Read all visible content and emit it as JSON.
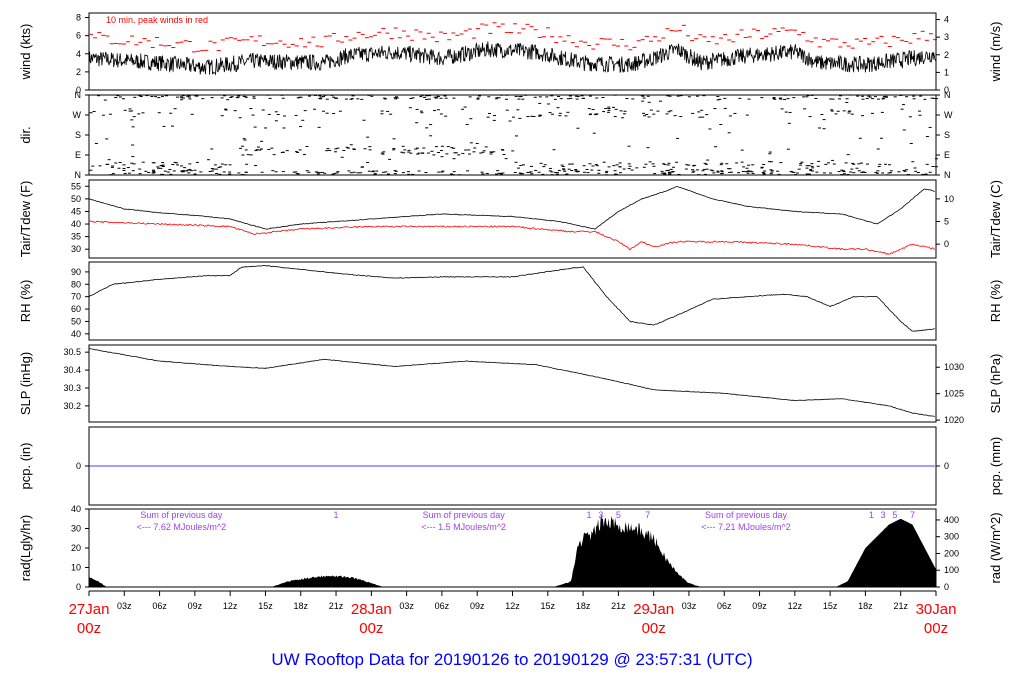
{
  "title": "UW Rooftop Data for 20190126  to  20190129 @ 23:57:31  (UTC)",
  "chart_data": [
    {
      "id": "wind",
      "type": "line",
      "ylabel": "wind (kts)",
      "ylabel_right": "wind (m/s)",
      "ylim": [
        0,
        8.5
      ],
      "yticks": [
        0,
        2,
        4,
        6,
        8
      ],
      "yticks_right": [
        0,
        1,
        2,
        3,
        4
      ],
      "right_scale": 0.5144,
      "annotation": "10 min. peak winds in red",
      "series": [
        {
          "name": "wind",
          "color": "#000000",
          "points": [
            [
              0,
              3.5
            ],
            [
              6,
              3
            ],
            [
              10,
              2.5
            ],
            [
              14,
              3.2
            ],
            [
              20,
              3
            ],
            [
              22,
              3.8
            ],
            [
              26,
              4.2
            ],
            [
              30,
              3.5
            ],
            [
              34,
              4.5
            ],
            [
              38,
              4.2
            ],
            [
              42,
              3
            ],
            [
              46,
              2.8
            ],
            [
              48,
              3.5
            ],
            [
              50,
              4.5
            ],
            [
              52,
              3
            ],
            [
              56,
              3.8
            ],
            [
              60,
              4.2
            ],
            [
              62,
              3
            ],
            [
              66,
              2.8
            ],
            [
              70,
              3.5
            ],
            [
              72,
              4
            ]
          ]
        }
      ]
    },
    {
      "id": "dir",
      "type": "scatter",
      "ylabel": "dir.",
      "ylim": [
        0,
        360
      ],
      "yticks_labels": [
        "N",
        "E",
        "S",
        "W",
        "N"
      ],
      "yticks": [
        0,
        90,
        180,
        270,
        360
      ]
    },
    {
      "id": "temp",
      "type": "line",
      "ylabel": "Tair/Tdew (F)",
      "ylabel_right": "Tair/Tdew (C)",
      "ylim": [
        26.5,
        57.5
      ],
      "yticks": [
        30,
        35,
        40,
        45,
        50,
        55
      ],
      "yticks_right": [
        0,
        5,
        10
      ],
      "series": [
        {
          "name": "Tair",
          "color": "#000000",
          "points": [
            [
              0,
              50
            ],
            [
              3,
              46
            ],
            [
              6,
              44.5
            ],
            [
              10,
              43
            ],
            [
              12,
              42
            ],
            [
              15,
              38
            ],
            [
              18,
              40
            ],
            [
              24,
              42
            ],
            [
              30,
              44
            ],
            [
              36,
              43
            ],
            [
              40,
              41
            ],
            [
              43,
              38
            ],
            [
              45,
              45
            ],
            [
              47,
              50
            ],
            [
              49,
              53
            ],
            [
              50,
              55
            ],
            [
              53,
              50
            ],
            [
              56,
              47
            ],
            [
              60,
              45
            ],
            [
              64,
              44
            ],
            [
              67,
              40
            ],
            [
              69,
              46
            ],
            [
              71,
              54
            ],
            [
              72,
              53
            ]
          ]
        },
        {
          "name": "Tdew",
          "color": "#ff0000",
          "points": [
            [
              0,
              41
            ],
            [
              6,
              40
            ],
            [
              12,
              39
            ],
            [
              14,
              36
            ],
            [
              18,
              38
            ],
            [
              24,
              39
            ],
            [
              36,
              39
            ],
            [
              41,
              37
            ],
            [
              43,
              37
            ],
            [
              44,
              35
            ],
            [
              45,
              33
            ],
            [
              46,
              30
            ],
            [
              47,
              33
            ],
            [
              48,
              31
            ],
            [
              50,
              33
            ],
            [
              54,
              33
            ],
            [
              60,
              32
            ],
            [
              64,
              30
            ],
            [
              66,
              30
            ],
            [
              68,
              28
            ],
            [
              70,
              32
            ],
            [
              72,
              30
            ]
          ]
        }
      ]
    },
    {
      "id": "rh",
      "type": "line",
      "ylabel": "RH (%)",
      "ylabel_right": "RH (%)",
      "ylim": [
        35,
        98
      ],
      "yticks": [
        40,
        50,
        60,
        70,
        80,
        90
      ],
      "series": [
        {
          "name": "RH",
          "color": "#000000",
          "points": [
            [
              0,
              70
            ],
            [
              2,
              80
            ],
            [
              6,
              84
            ],
            [
              10,
              87
            ],
            [
              12,
              87
            ],
            [
              13,
              94
            ],
            [
              15,
              95
            ],
            [
              18,
              92
            ],
            [
              22,
              88
            ],
            [
              26,
              85
            ],
            [
              30,
              86
            ],
            [
              36,
              86
            ],
            [
              41,
              93
            ],
            [
              42,
              94
            ],
            [
              44,
              70
            ],
            [
              46,
              50
            ],
            [
              48,
              47
            ],
            [
              50,
              55
            ],
            [
              53,
              68
            ],
            [
              56,
              70
            ],
            [
              59,
              72
            ],
            [
              61,
              70
            ],
            [
              63,
              62
            ],
            [
              65,
              70
            ],
            [
              67,
              70
            ],
            [
              69,
              50
            ],
            [
              70,
              42
            ],
            [
              72,
              44
            ]
          ]
        }
      ]
    },
    {
      "id": "slp",
      "type": "line",
      "ylabel": "SLP (inHg)",
      "ylabel_right": "SLP (hPa)",
      "ylim": [
        30.11,
        30.54
      ],
      "yticks": [
        30.2,
        30.3,
        30.4,
        30.5
      ],
      "yticks_right": [
        1020,
        1025,
        1030
      ],
      "series": [
        {
          "name": "SLP",
          "color": "#000000",
          "points": [
            [
              0,
              30.52
            ],
            [
              6,
              30.45
            ],
            [
              12,
              30.42
            ],
            [
              15,
              30.41
            ],
            [
              20,
              30.46
            ],
            [
              26,
              30.42
            ],
            [
              32,
              30.45
            ],
            [
              38,
              30.43
            ],
            [
              44,
              30.35
            ],
            [
              48,
              30.29
            ],
            [
              54,
              30.27
            ],
            [
              60,
              30.23
            ],
            [
              64,
              30.24
            ],
            [
              68,
              30.2
            ],
            [
              70,
              30.16
            ],
            [
              72,
              30.14
            ]
          ]
        }
      ]
    },
    {
      "id": "pcp",
      "type": "line",
      "ylabel": "pcp. (in)",
      "ylabel_right": "pcp. (mm)",
      "yticks": [
        0
      ],
      "yticks_right": [
        0
      ],
      "series": [
        {
          "name": "pcp",
          "color": "#0000ff",
          "points": [
            [
              0,
              0
            ],
            [
              72,
              0
            ]
          ]
        }
      ]
    },
    {
      "id": "rad",
      "type": "area",
      "ylabel": "rad(Lgly/hr)",
      "ylabel_right": "rad (W/m^2)",
      "ylim": [
        0,
        40
      ],
      "yticks": [
        0,
        10,
        20,
        30,
        40
      ],
      "yticks_right": [
        0,
        100,
        200,
        300,
        400
      ],
      "series": [
        {
          "name": "rad",
          "color": "#000000",
          "points": [
            [
              0,
              5
            ],
            [
              0.5,
              4
            ],
            [
              1.5,
              0
            ],
            [
              15.5,
              0
            ],
            [
              17,
              3
            ],
            [
              19,
              5
            ],
            [
              20.5,
              6
            ],
            [
              22,
              5
            ],
            [
              23,
              4
            ],
            [
              24,
              2
            ],
            [
              25,
              0
            ],
            [
              39.5,
              0
            ],
            [
              41,
              3
            ],
            [
              41.5,
              20
            ],
            [
              42,
              25
            ],
            [
              43,
              28
            ],
            [
              43.5,
              34
            ],
            [
              45,
              32
            ],
            [
              46.5,
              30
            ],
            [
              48,
              25
            ],
            [
              49,
              15
            ],
            [
              50,
              7
            ],
            [
              51,
              2
            ],
            [
              52,
              0
            ],
            [
              63.5,
              0
            ],
            [
              64.5,
              3
            ],
            [
              66,
              20
            ],
            [
              68,
              32
            ],
            [
              69,
              35
            ],
            [
              70,
              32
            ],
            [
              72,
              9
            ]
          ]
        }
      ],
      "annotations": [
        {
          "text1": "Sum of previous day",
          "text2": "<--- 7.62 MJoules/m^2",
          "hour": 7
        },
        {
          "text1": "Sum of previous day",
          "text2": "<--- 1.5 MJoules/m^2",
          "hour": 31
        },
        {
          "text1": "Sum of previous day",
          "text2": "<--- 7.21 MJoules/m^2",
          "hour": 55
        }
      ],
      "hour_marks": [
        {
          "label": "1",
          "hour": 21
        },
        {
          "label": "1",
          "hour": 42.5
        },
        {
          "label": "3",
          "hour": 43.5
        },
        {
          "label": "5",
          "hour": 45
        },
        {
          "label": "7",
          "hour": 47.5
        },
        {
          "label": "1",
          "hour": 66.5
        },
        {
          "label": "3",
          "hour": 67.5
        },
        {
          "label": "5",
          "hour": 68.5
        },
        {
          "label": "7",
          "hour": 70
        }
      ]
    },
    {
      "id": "xaxis",
      "xlim": [
        0,
        72
      ],
      "xticks_minor": [
        "03z",
        "06z",
        "09z",
        "12z",
        "15z",
        "18z",
        "21z"
      ],
      "dates": [
        {
          "hour": 0,
          "day": "27Jan",
          "time": "00z"
        },
        {
          "hour": 24,
          "day": "28Jan",
          "time": "00z"
        },
        {
          "hour": 48,
          "day": "29Jan",
          "time": "00z"
        },
        {
          "hour": 72,
          "day": "30Jan",
          "time": "00z"
        }
      ]
    }
  ]
}
